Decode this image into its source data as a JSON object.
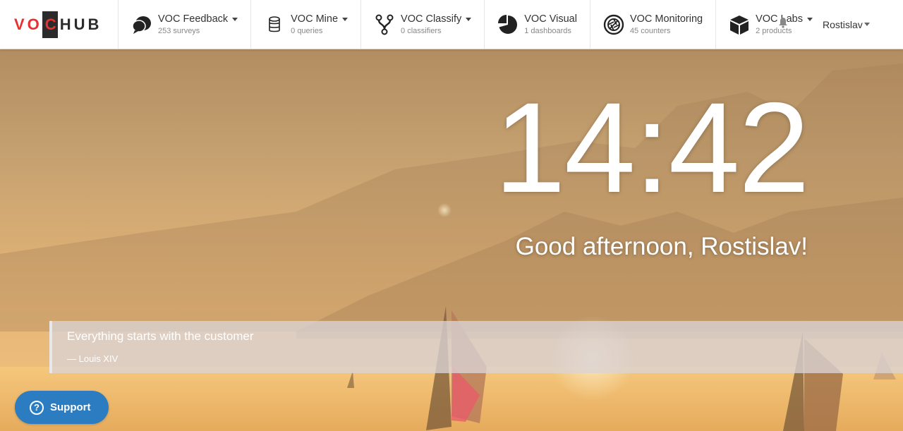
{
  "brand": {
    "logo_part1": "VO",
    "logo_part2": "C",
    "logo_part3": "HUB"
  },
  "nav": [
    {
      "label": "VOC Feedback",
      "sub": "253 surveys",
      "icon": "chat-bubbles-icon",
      "has_caret": true
    },
    {
      "label": "VOC Mine",
      "sub": "0 queries",
      "icon": "database-icon",
      "has_caret": true
    },
    {
      "label": "VOC Classify",
      "sub": "0 classifiers",
      "icon": "branch-icon",
      "has_caret": true
    },
    {
      "label": "VOC Visual",
      "sub": "1 dashboards",
      "icon": "pie-chart-icon",
      "has_caret": false
    },
    {
      "label": "VOC Monitoring",
      "sub": "45 counters",
      "icon": "aperture-icon",
      "has_caret": false
    },
    {
      "label": "VOC Labs",
      "sub": "2 products",
      "icon": "cube-icon",
      "has_caret": true
    }
  ],
  "user": {
    "name": "Rostislav"
  },
  "clock": {
    "time": "14:42"
  },
  "greeting": "Good afternoon, Rostislav!",
  "quote": {
    "text": "Everything starts with the customer",
    "author": "—  Louis XIV"
  },
  "support": {
    "label": "Support",
    "icon": "question-circle-icon"
  },
  "colors": {
    "brand_red": "#e8312f",
    "support_blue": "#2b7cc1",
    "nav_bg": "#ffffff"
  }
}
